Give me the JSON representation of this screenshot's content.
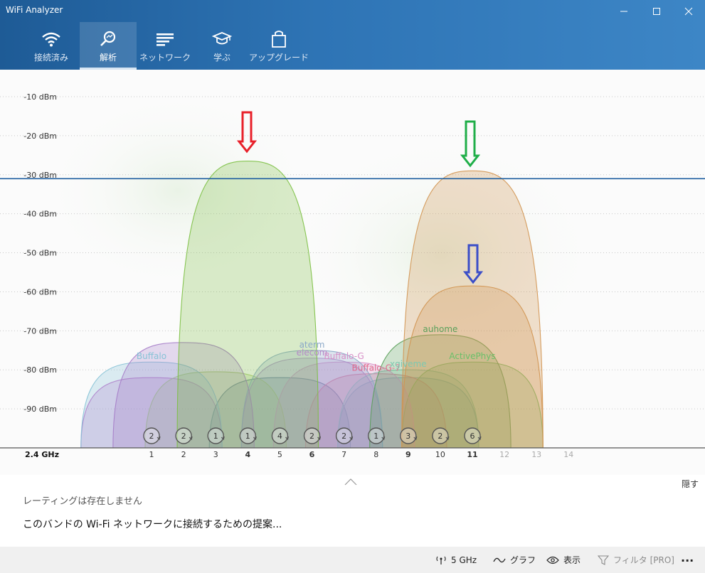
{
  "window": {
    "title": "WiFi Analyzer"
  },
  "nav": [
    {
      "label": "接続済み",
      "icon": "wifi-icon"
    },
    {
      "label": "解析",
      "icon": "analyze-icon"
    },
    {
      "label": "ネットワーク",
      "icon": "network-list-icon"
    },
    {
      "label": "学ぶ",
      "icon": "graduation-cap-icon"
    },
    {
      "label": "アップグレード",
      "icon": "shopping-bag-icon"
    }
  ],
  "colors": {
    "accent": "#2e74b5",
    "threshold_line": "#1f5fa0",
    "arrow_red": "#e8202a",
    "arrow_green": "#1fae48",
    "arrow_blue": "#3b4ec8"
  },
  "chart_data": {
    "type": "area",
    "band_label": "2.4 GHz",
    "y_ticks": [
      "-10 dBm",
      "-20 dBm",
      "-30 dBm",
      "-40 dBm",
      "-50 dBm",
      "-60 dBm",
      "-70 dBm",
      "-80 dBm",
      "-90 dBm"
    ],
    "ylim": [
      -100,
      -6
    ],
    "x_ticks": [
      "1",
      "2",
      "3",
      "4",
      "5",
      "6",
      "7",
      "8",
      "9",
      "10",
      "11",
      "12",
      "13",
      "14"
    ],
    "threshold_dbm": -31,
    "channel_counts": [
      {
        "channel": 1,
        "count": "2"
      },
      {
        "channel": 2,
        "count": "2"
      },
      {
        "channel": 3,
        "count": "1"
      },
      {
        "channel": 4,
        "count": "1"
      },
      {
        "channel": 5,
        "count": "4"
      },
      {
        "channel": 6,
        "count": "2"
      },
      {
        "channel": 7,
        "count": "2"
      },
      {
        "channel": 8,
        "count": "1"
      },
      {
        "channel": 9,
        "count": "3"
      },
      {
        "channel": 10,
        "count": "2"
      },
      {
        "channel": 11,
        "count": "6"
      }
    ],
    "networks": [
      {
        "channel": 4,
        "signal": -26.5,
        "color": "#7cc043",
        "label": ""
      },
      {
        "channel": 11,
        "signal": -29,
        "color": "#d29450",
        "label": ""
      },
      {
        "channel": 11,
        "signal": -58.5,
        "color": "#d29450",
        "label": ""
      },
      {
        "channel": 10,
        "signal": -71,
        "color": "#5aa05a",
        "label": "auhome"
      },
      {
        "channel": 11,
        "signal": -78,
        "color": "#69c069",
        "label": "ActivePhys"
      },
      {
        "channel": 2,
        "signal": -73,
        "color": "#a57cc8",
        "label": ""
      },
      {
        "channel": 1,
        "signal": -78,
        "color": "#86c2d6",
        "label": "Buffalo"
      },
      {
        "channel": 1,
        "signal": -82,
        "color": "#c06cc8",
        "label": ""
      },
      {
        "channel": 3,
        "signal": -80.5,
        "color": "#a8c870",
        "label": ""
      },
      {
        "channel": 5,
        "signal": -82,
        "color": "#4a7090",
        "label": ""
      },
      {
        "channel": 6,
        "signal": -75,
        "color": "#8aa8c8",
        "label": "aterm"
      },
      {
        "channel": 6,
        "signal": -77,
        "color": "#b488c8",
        "label": "elecom"
      },
      {
        "channel": 7,
        "signal": -78,
        "color": "#d890c8",
        "label": "Buffalo-G"
      },
      {
        "channel": 8,
        "signal": -81,
        "color": "#e06a8c",
        "label": "Buffalo-G-7"
      },
      {
        "channel": 9,
        "signal": -80,
        "color": "#7ec8b0",
        "label": "xgiveme"
      },
      {
        "channel": 9,
        "signal": -82,
        "color": "#6aa8c0",
        "label": ""
      }
    ]
  },
  "panel": {
    "rating_text": "レーティングは存在しません",
    "suggestion_text": "このバンドの Wi-Fi ネットワークに接続するための提案...",
    "hide_label": "隠す"
  },
  "footer": {
    "band_label": "5 GHz",
    "graph_label": "グラフ",
    "view_label": "表示",
    "filter_label": "フィルタ [PRO]",
    "more_label": "..."
  }
}
